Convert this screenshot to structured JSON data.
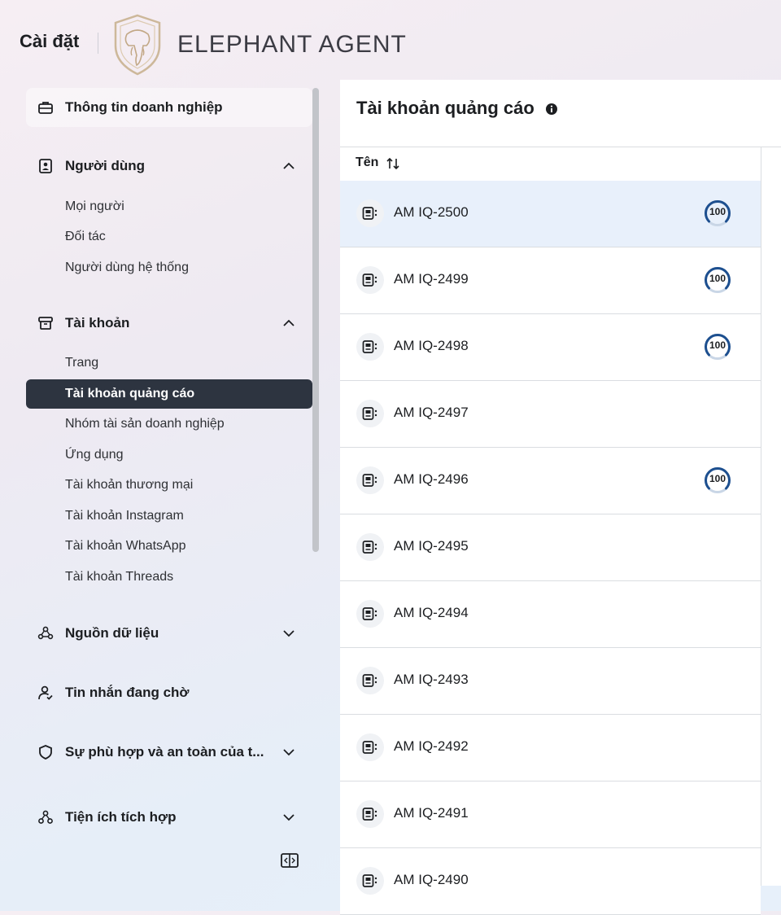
{
  "topbar": {
    "settings_title": "Cài đặt",
    "brand": "ELEPHANT AGENT",
    "logo_icon": "elephant-shield-logo"
  },
  "colors": {
    "selected_bg": "#2d3440",
    "highlight_row": "#e8f0fb",
    "score_ring": "#1d4f8f"
  },
  "sidebar": {
    "sections": [
      {
        "label": "Thông tin doanh nghiệp",
        "icon": "briefcase-icon"
      },
      {
        "label": "Người dùng",
        "icon": "user-badge-icon",
        "expanded": true,
        "items": [
          "Mọi người",
          "Đối tác",
          "Người dùng hệ thống"
        ]
      },
      {
        "label": "Tài khoản",
        "icon": "archive-icon",
        "expanded": true,
        "items": [
          "Trang",
          "Tài khoản quảng cáo",
          "Nhóm tài sản doanh nghiệp",
          "Ứng dụng",
          "Tài khoản thương mại",
          "Tài khoản Instagram",
          "Tài khoản WhatsApp",
          "Tài khoản Threads"
        ],
        "selected": "Tài khoản quảng cáo"
      },
      {
        "label": "Nguồn dữ liệu",
        "icon": "people-network-icon",
        "expanded": false
      },
      {
        "label": "Tin nhắn đang chờ",
        "icon": "person-clock-icon"
      },
      {
        "label": "Sự phù hợp và an toàn của t...",
        "icon": "shield-icon",
        "expanded": false
      },
      {
        "label": "Tiện ích tích hợp",
        "icon": "integration-icon",
        "expanded": false
      }
    ]
  },
  "main": {
    "title": "Tài khoản quảng cáo",
    "column_name": "Tên",
    "rows": [
      {
        "name": "AM IQ-2500",
        "score": "100"
      },
      {
        "name": "AM IQ-2499",
        "score": "100"
      },
      {
        "name": "AM IQ-2498",
        "score": "100"
      },
      {
        "name": "AM IQ-2497",
        "score": ""
      },
      {
        "name": "AM IQ-2496",
        "score": "100"
      },
      {
        "name": "AM IQ-2495",
        "score": ""
      },
      {
        "name": "AM IQ-2494",
        "score": ""
      },
      {
        "name": "AM IQ-2493",
        "score": ""
      },
      {
        "name": "AM IQ-2492",
        "score": ""
      },
      {
        "name": "AM IQ-2491",
        "score": ""
      },
      {
        "name": "AM IQ-2490",
        "score": ""
      }
    ]
  }
}
